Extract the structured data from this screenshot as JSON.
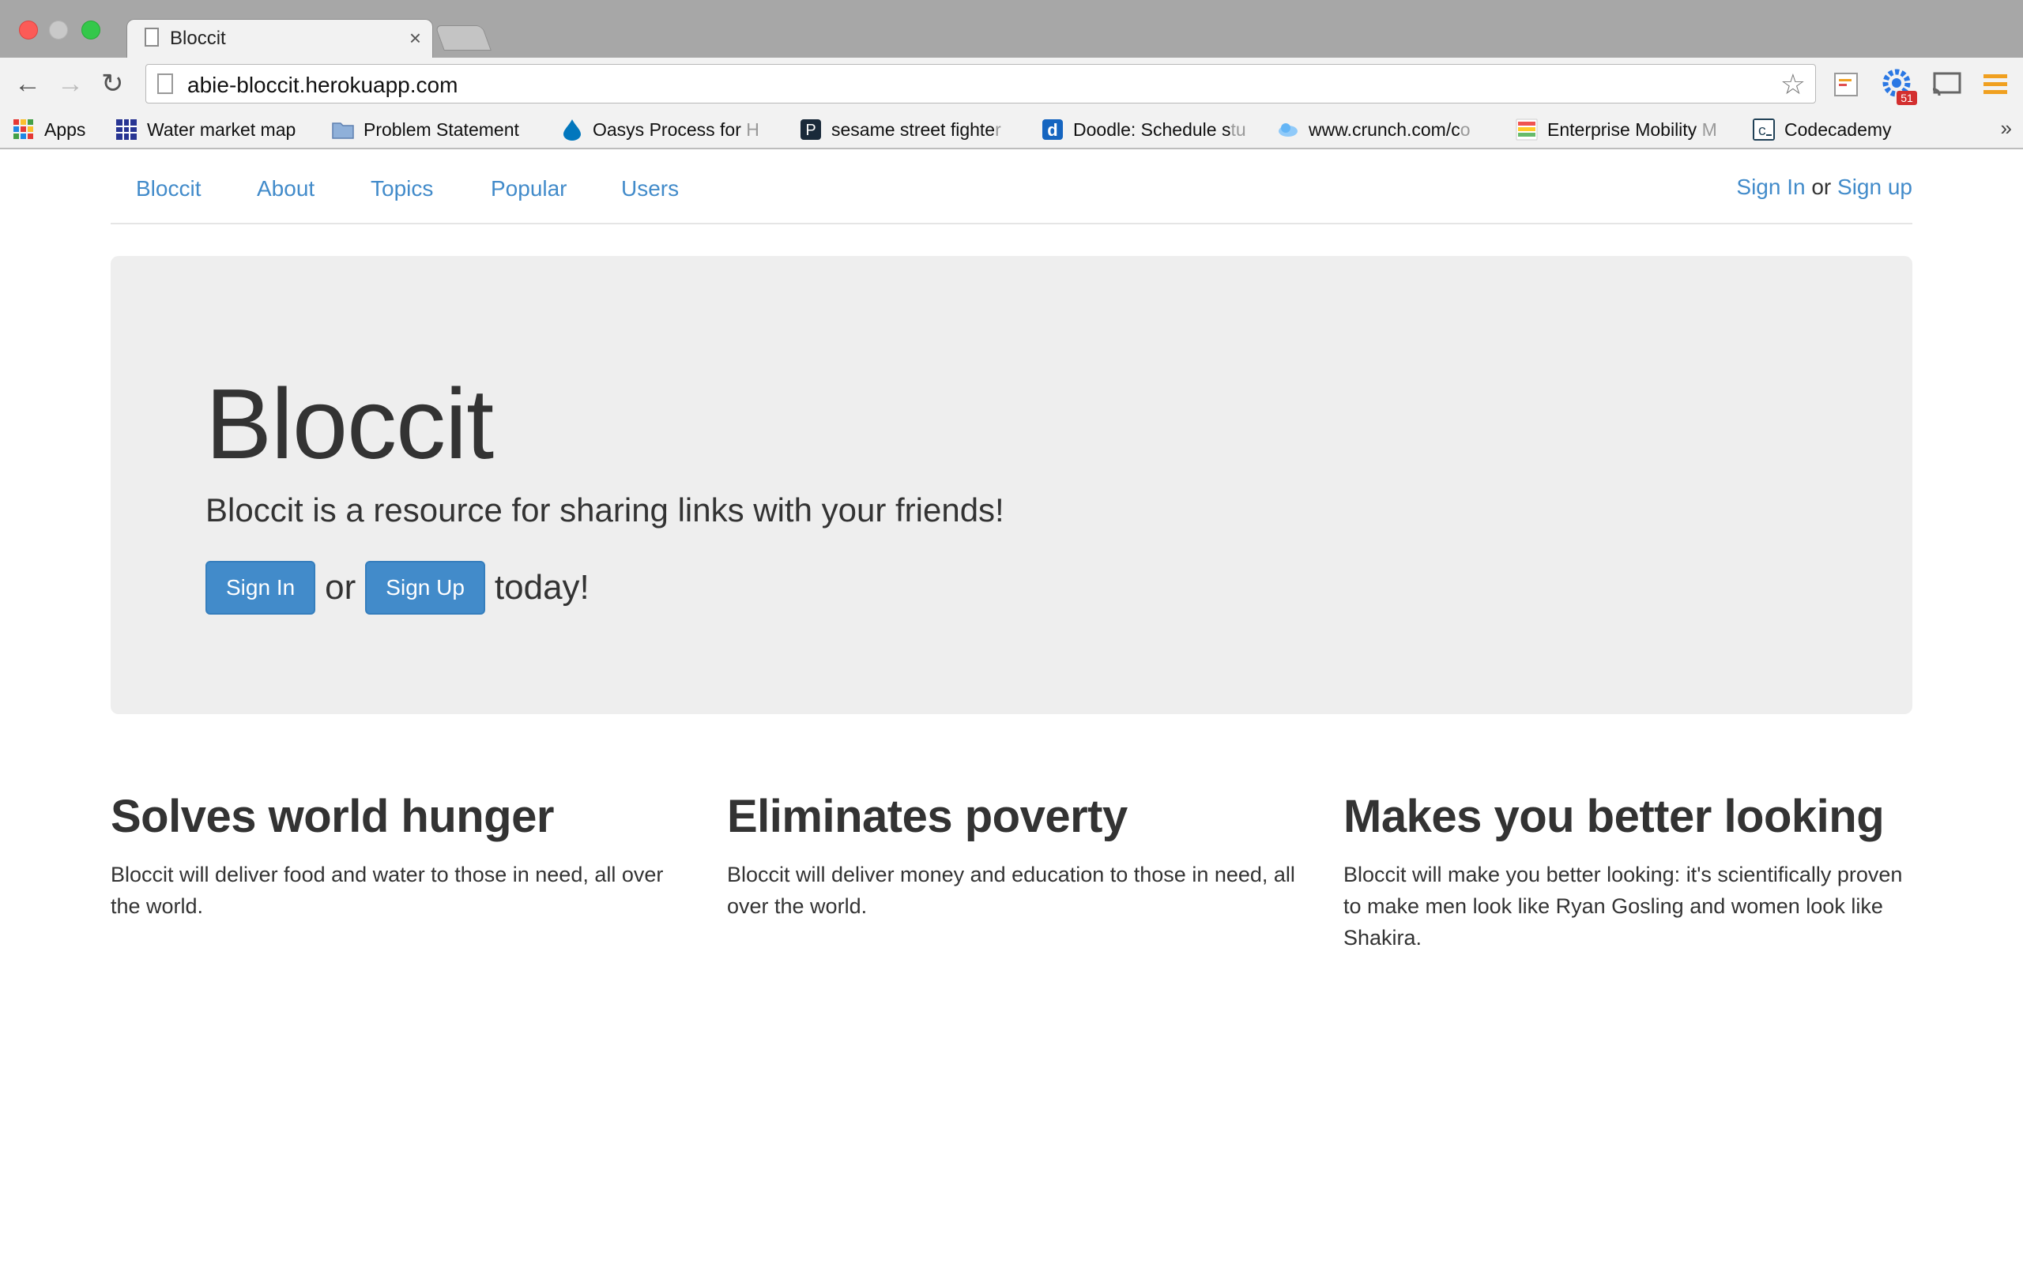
{
  "browser": {
    "tab_title": "Bloccit",
    "tab_close": "×",
    "url": "abie-bloccit.herokuapp.com",
    "extension_badge": "51",
    "bookmarks": [
      {
        "label": "Apps",
        "faded": ""
      },
      {
        "label": "Water market map",
        "faded": ""
      },
      {
        "label": "Problem Statement",
        "faded": ""
      },
      {
        "label": "Oasys Process for ",
        "faded": "H"
      },
      {
        "label": "sesame street fighte",
        "faded": "r"
      },
      {
        "label": "Doodle: Schedule s",
        "faded": "tu"
      },
      {
        "label": "www.crunch.com/c",
        "faded": "o"
      },
      {
        "label": "Enterprise Mobility ",
        "faded": "M"
      },
      {
        "label": "Codecademy",
        "faded": ""
      }
    ],
    "overflow": "»"
  },
  "site": {
    "nav": [
      "Bloccit",
      "About",
      "Topics",
      "Popular",
      "Users"
    ],
    "auth": {
      "sign_in": "Sign In",
      "or": "or",
      "sign_up": "Sign up"
    }
  },
  "hero": {
    "title": "Bloccit",
    "lead": "Bloccit is a resource for sharing links with your friends!",
    "sign_in_button": "Sign In",
    "or": "or",
    "sign_up_button": "Sign Up",
    "suffix": "today!"
  },
  "features": [
    {
      "title": "Solves world hunger",
      "body": "Bloccit will deliver food and water to those in need, all over the world."
    },
    {
      "title": "Eliminates poverty",
      "body": "Bloccit will deliver money and education to those in need, all over the world."
    },
    {
      "title": "Makes you better looking",
      "body": "Bloccit will make you better looking: it's scientifically proven to make men look like Ryan Gosling and women look like Shakira."
    }
  ],
  "colors": {
    "link": "#428bca",
    "button": "#428bca",
    "jumbotron_bg": "#eeeeee"
  }
}
